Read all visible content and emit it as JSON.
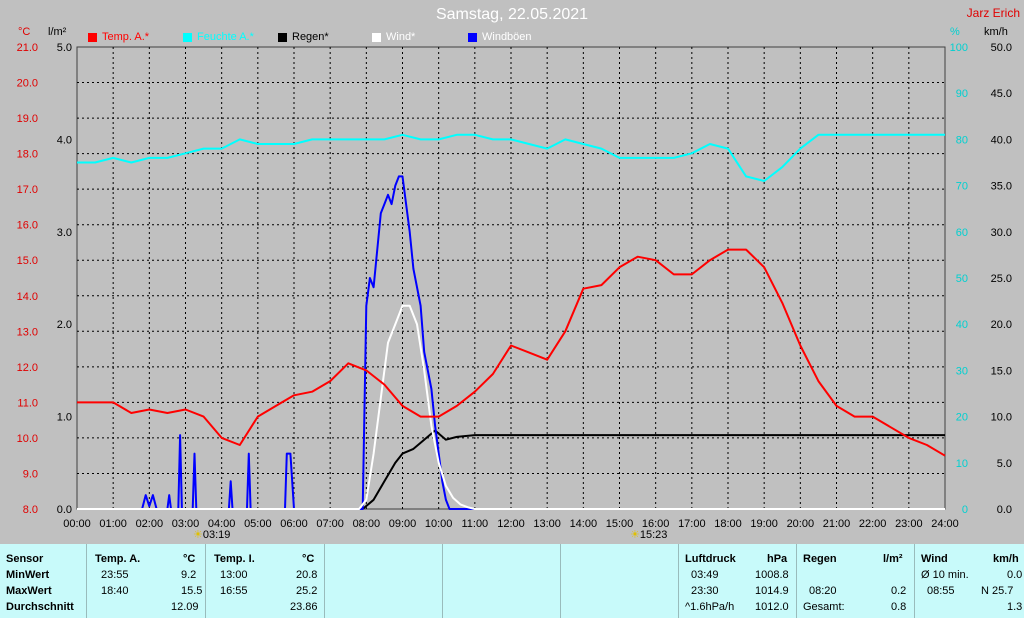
{
  "header": {
    "title": "Samstag, 22.05.2021",
    "author": "Jarz Erich",
    "unit_temp": "°C",
    "unit_rain": "l/m²",
    "unit_hum": "%",
    "unit_wind": "km/h"
  },
  "legend": [
    {
      "label": "Temp. A.*",
      "color": "#ff0000"
    },
    {
      "label": "Feuchte A.*",
      "color": "#00ffff"
    },
    {
      "label": "Regen*",
      "color": "#000000"
    },
    {
      "label": "Wind*",
      "color": "#ffffff"
    },
    {
      "label": "Windböen",
      "color": "#0000ff"
    }
  ],
  "sun": {
    "rise": "03:19",
    "set": "15:23"
  },
  "chart_data": {
    "type": "line",
    "title": "Samstag, 22.05.2021",
    "x_unit": "hours",
    "xlim": [
      0,
      24
    ],
    "x_ticks": [
      "00:00",
      "01:00",
      "02:00",
      "03:00",
      "04:00",
      "05:00",
      "06:00",
      "07:00",
      "08:00",
      "09:00",
      "10:00",
      "11:00",
      "12:00",
      "13:00",
      "14:00",
      "15:00",
      "16:00",
      "17:00",
      "18:00",
      "19:00",
      "20:00",
      "21:00",
      "22:00",
      "23:00",
      "24:00"
    ],
    "axes": {
      "temp": {
        "label": "°C",
        "range": [
          8.0,
          21.0
        ],
        "ticks": [
          "8.0",
          "9.0",
          "10.0",
          "11.0",
          "12.0",
          "13.0",
          "14.0",
          "15.0",
          "16.0",
          "17.0",
          "18.0",
          "19.0",
          "20.0",
          "21.0"
        ]
      },
      "rain": {
        "label": "l/m²",
        "range": [
          0,
          5.0
        ],
        "ticks": [
          "0.0",
          "1.0",
          "2.0",
          "3.0",
          "4.0",
          "5.0"
        ]
      },
      "humidity": {
        "label": "%",
        "range": [
          0,
          100
        ],
        "ticks": [
          "0",
          "10",
          "20",
          "30",
          "40",
          "50",
          "60",
          "70",
          "80",
          "90",
          "100"
        ]
      },
      "wind": {
        "label": "km/h",
        "range": [
          0,
          50
        ],
        "ticks": [
          "0.0",
          "5.0",
          "10.0",
          "15.0",
          "20.0",
          "25.0",
          "30.0",
          "35.0",
          "40.0",
          "45.0",
          "50.0"
        ]
      }
    },
    "series": [
      {
        "name": "Temp. A.*",
        "axis": "temp",
        "color": "#ff0000",
        "x": [
          0,
          0.5,
          1,
          1.5,
          2,
          2.5,
          3,
          3.5,
          4,
          4.5,
          5,
          5.5,
          6,
          6.5,
          7,
          7.5,
          8,
          8.5,
          9,
          9.5,
          10,
          10.5,
          11,
          11.5,
          12,
          12.5,
          13,
          13.5,
          14,
          14.5,
          15,
          15.5,
          16,
          16.5,
          17,
          17.5,
          18,
          18.5,
          19,
          19.5,
          20,
          20.5,
          21,
          21.5,
          22,
          22.5,
          23,
          23.5,
          24
        ],
        "y": [
          11.0,
          11.0,
          11.0,
          10.7,
          10.8,
          10.7,
          10.8,
          10.6,
          10.0,
          9.8,
          10.6,
          10.9,
          11.2,
          11.3,
          11.6,
          12.1,
          11.9,
          11.5,
          10.9,
          10.6,
          10.6,
          10.9,
          11.3,
          11.8,
          12.6,
          12.4,
          12.2,
          13.0,
          14.2,
          14.3,
          14.8,
          15.1,
          15.0,
          14.6,
          14.6,
          15.0,
          15.3,
          15.3,
          14.8,
          13.8,
          12.6,
          11.6,
          10.9,
          10.6,
          10.6,
          10.3,
          10.0,
          9.8,
          9.5
        ]
      },
      {
        "name": "Feuchte A.*",
        "axis": "humidity",
        "color": "#00ffff",
        "x": [
          0,
          0.5,
          1,
          1.5,
          2,
          2.5,
          3,
          3.5,
          4,
          4.5,
          5,
          5.5,
          6,
          6.5,
          7,
          7.5,
          8,
          8.5,
          9,
          9.5,
          10,
          10.5,
          11,
          11.5,
          12,
          12.5,
          13,
          13.5,
          14,
          14.5,
          15,
          15.5,
          16,
          16.5,
          17,
          17.5,
          18,
          18.5,
          19,
          19.5,
          20,
          20.5,
          21,
          21.5,
          22,
          22.5,
          23,
          23.5,
          24
        ],
        "y": [
          75,
          75,
          76,
          75,
          76,
          76,
          77,
          78,
          78,
          80,
          79,
          79,
          79,
          80,
          80,
          80,
          80,
          80,
          81,
          80,
          80,
          81,
          81,
          80,
          80,
          79,
          78,
          80,
          79,
          78,
          76,
          76,
          76,
          76,
          77,
          79,
          78,
          72,
          71,
          74,
          78,
          81,
          81,
          81,
          81,
          81,
          81,
          81,
          81
        ]
      },
      {
        "name": "Regen*",
        "axis": "rain",
        "color": "#000000",
        "x": [
          0,
          7.9,
          8.2,
          8.5,
          8.8,
          9.0,
          9.3,
          9.6,
          9.9,
          10.2,
          10.5,
          11.0,
          24
        ],
        "y": [
          0,
          0,
          0.1,
          0.3,
          0.5,
          0.6,
          0.65,
          0.75,
          0.85,
          0.75,
          0.78,
          0.8,
          0.8
        ]
      },
      {
        "name": "Wind*",
        "axis": "wind",
        "color": "#ffffff",
        "x": [
          0,
          7.8,
          8.0,
          8.2,
          8.4,
          8.6,
          8.8,
          9.0,
          9.2,
          9.4,
          9.6,
          9.8,
          10.0,
          10.2,
          10.4,
          10.6,
          10.8,
          11.0,
          24
        ],
        "y": [
          0,
          0,
          1,
          6,
          12,
          18,
          20,
          22,
          22,
          20,
          15,
          9,
          5,
          2.5,
          1.2,
          0.5,
          0.2,
          0,
          0
        ]
      },
      {
        "name": "Windböen",
        "axis": "wind",
        "color": "#0000ff",
        "x": [
          0,
          1.8,
          1.9,
          2.0,
          2.1,
          2.2,
          2.5,
          2.55,
          2.6,
          2.8,
          2.85,
          2.9,
          3.2,
          3.25,
          3.3,
          4.2,
          4.25,
          4.3,
          4.7,
          4.75,
          4.8,
          5.7,
          5.75,
          5.8,
          5.9,
          6.0,
          6.1,
          7.9,
          8.0,
          8.1,
          8.2,
          8.3,
          8.4,
          8.5,
          8.6,
          8.7,
          8.8,
          8.9,
          9.0,
          9.1,
          9.2,
          9.3,
          9.4,
          9.5,
          9.6,
          9.7,
          9.8,
          9.9,
          10.0,
          10.1,
          10.2,
          10.3,
          10.4,
          24
        ],
        "y": [
          0,
          0,
          1.5,
          0.3,
          1.5,
          0,
          0,
          1.5,
          0,
          0,
          8,
          0,
          0,
          6,
          0,
          0,
          3,
          0,
          0,
          6,
          0,
          0,
          0,
          6,
          6,
          0,
          0,
          0,
          22,
          25,
          24,
          28,
          32,
          33,
          34,
          33,
          35,
          36,
          36,
          33,
          30,
          26,
          24,
          22,
          17,
          15,
          13,
          9,
          6,
          3,
          1,
          0,
          0,
          0
        ]
      }
    ]
  },
  "stats": {
    "sensor": {
      "head": "Sensor",
      "rows": [
        "MinWert",
        "MaxWert",
        "Durchschnitt"
      ]
    },
    "temp_a": {
      "head": "Temp. A.",
      "unit": "°C",
      "min_time": "23:55",
      "min_val": "9.2",
      "max_time": "18:40",
      "max_val": "15.5",
      "avg": "12.09"
    },
    "temp_i": {
      "head": "Temp. I.",
      "unit": "°C",
      "min_time": "13:00",
      "min_val": "20.8",
      "max_time": "16:55",
      "max_val": "25.2",
      "avg": "23.86"
    },
    "pressure": {
      "head": "Luftdruck",
      "unit": "hPa",
      "min_time": "03:49",
      "min_val": "1008.8",
      "max_time": "23:30",
      "max_val": "1014.9",
      "trend_label": "^1.6hPa/h",
      "current": "1012.0"
    },
    "rain": {
      "head": "Regen",
      "unit": "l/m²",
      "max_time": "08:20",
      "max_val": "0.2",
      "total_label": "Gesamt:",
      "total": "0.8"
    },
    "wind": {
      "head": "Wind",
      "unit": "km/h",
      "avg_label": "Ø 10 min.",
      "avg_val": "0.0",
      "max_time": "08:55",
      "max_val": "N 25.7",
      "last": "1.3"
    }
  }
}
